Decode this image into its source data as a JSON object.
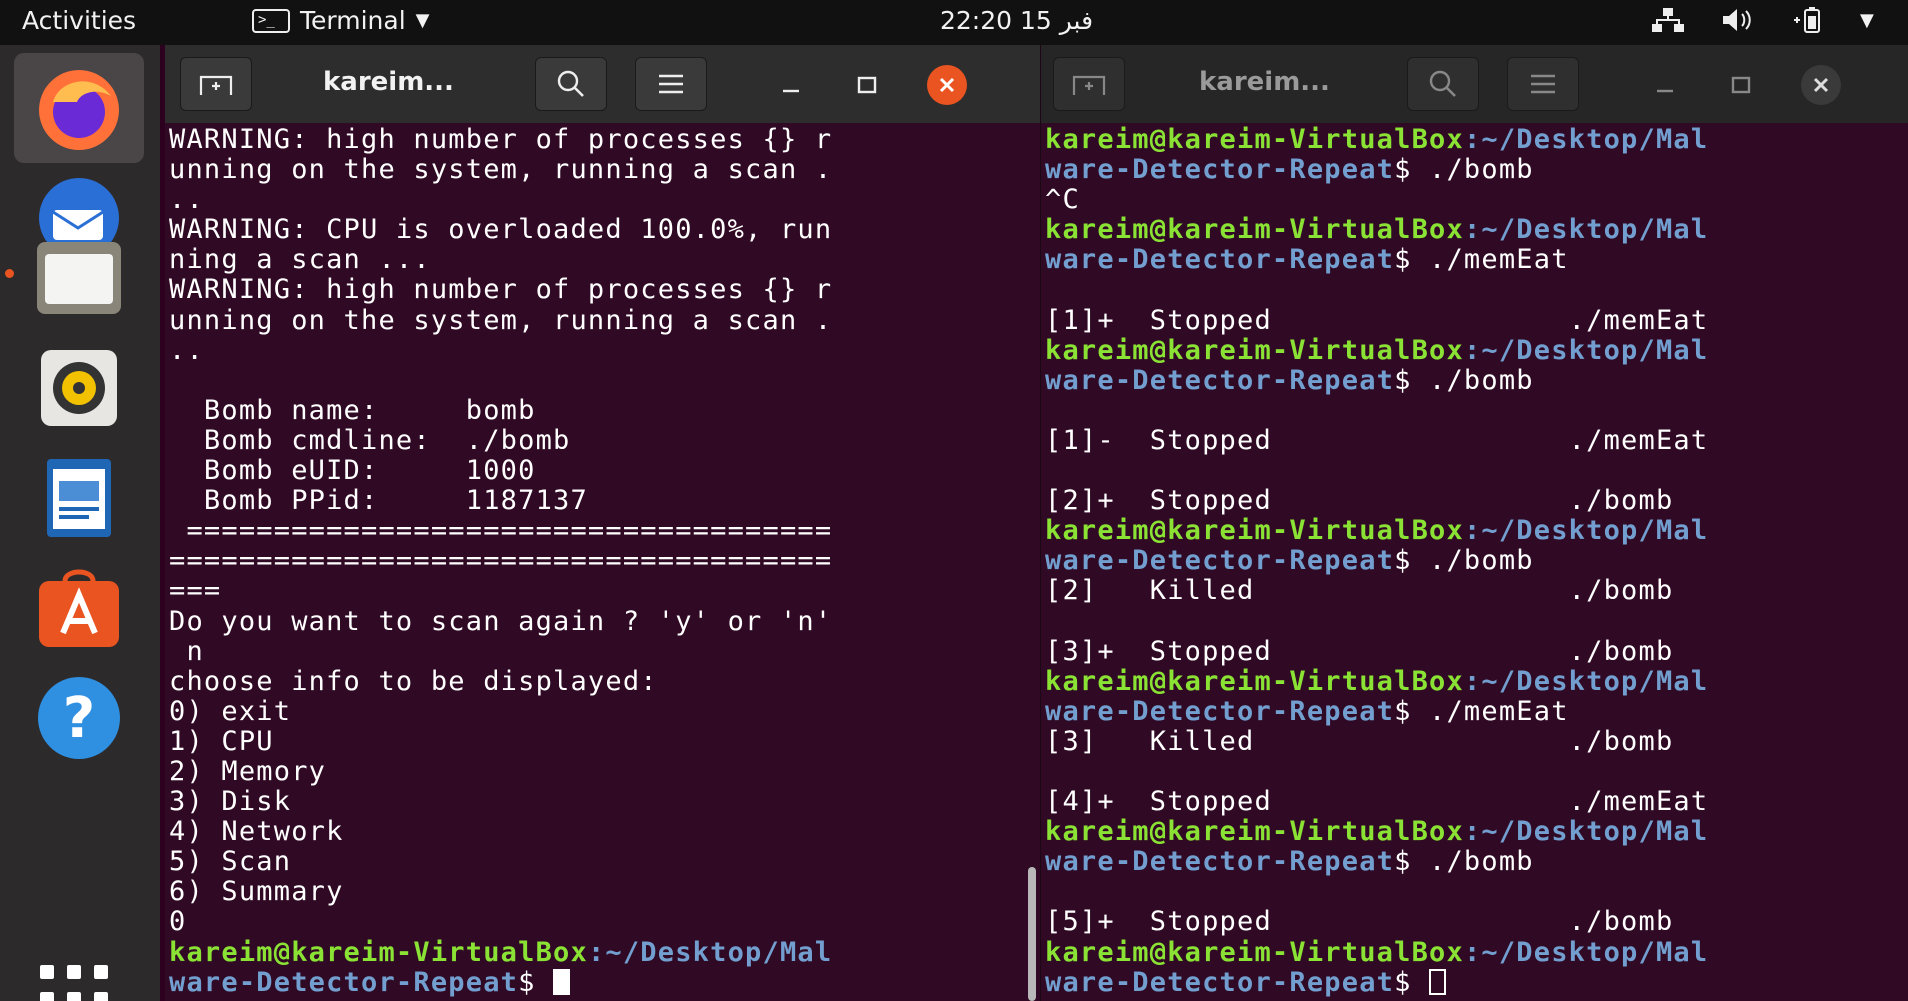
{
  "topbar": {
    "activities": "Activities",
    "app_name": "Terminal",
    "clock": "22:20  15 فبر",
    "tray_icons": [
      "network-icon",
      "volume-icon",
      "battery-icon",
      "system-menu-icon"
    ]
  },
  "dock": {
    "items": [
      {
        "name": "firefox",
        "active": true
      },
      {
        "name": "thunderbird"
      },
      {
        "name": "files",
        "running": true
      },
      {
        "name": "rhythmbox"
      },
      {
        "name": "libreoffice-writer"
      },
      {
        "name": "software-center"
      },
      {
        "name": "help"
      }
    ],
    "help_glyph": "?",
    "show_apps": "show-applications-icon"
  },
  "windows": {
    "left": {
      "title": "kareim...",
      "active": true,
      "lines": [
        {
          "t": "WARNING: high number of processes {} r"
        },
        {
          "t": "unning on the system, running a scan ."
        },
        {
          "t": ".."
        },
        {
          "t": "WARNING: CPU is overloaded 100.0%, run"
        },
        {
          "t": "ning a scan ..."
        },
        {
          "t": "WARNING: high number of processes {} r"
        },
        {
          "t": "unning on the system, running a scan ."
        },
        {
          "t": ".."
        },
        {
          "t": ""
        },
        {
          "t": "  Bomb name:     bomb"
        },
        {
          "t": "  Bomb cmdline:  ./bomb"
        },
        {
          "t": "  Bomb eUID:     1000"
        },
        {
          "t": "  Bomb PPid:     1187137"
        },
        {
          "t": " ====================================="
        },
        {
          "t": "======================================"
        },
        {
          "t": "==="
        },
        {
          "t": "Do you want to scan again ? 'y' or 'n'"
        },
        {
          "t": " n"
        },
        {
          "t": "choose info to be displayed:"
        },
        {
          "t": "0) exit"
        },
        {
          "t": "1) CPU"
        },
        {
          "t": "2) Memory"
        },
        {
          "t": "3) Disk"
        },
        {
          "t": "4) Network"
        },
        {
          "t": "5) Scan"
        },
        {
          "t": "6) Summary"
        },
        {
          "t": "0"
        },
        {
          "u": "kareim@kareim-VirtualBox",
          "p": ":~/Desktop/Mal"
        },
        {
          "p": "ware-Detector-Repeat",
          "t": "$ ",
          "cursor": "solid"
        }
      ]
    },
    "right": {
      "title": "kareim...",
      "active": false,
      "lines": [
        {
          "u": "kareim@kareim-VirtualBox",
          "p": ":~/Desktop/Mal"
        },
        {
          "p": "ware-Detector-Repeat",
          "t": "$ ./bomb"
        },
        {
          "t": "^C"
        },
        {
          "u": "kareim@kareim-VirtualBox",
          "p": ":~/Desktop/Mal"
        },
        {
          "p": "ware-Detector-Repeat",
          "t": "$ ./memEat"
        },
        {
          "t": ""
        },
        {
          "t": "[1]+  Stopped                 ./memEat"
        },
        {
          "u": "kareim@kareim-VirtualBox",
          "p": ":~/Desktop/Mal"
        },
        {
          "p": "ware-Detector-Repeat",
          "t": "$ ./bomb"
        },
        {
          "t": ""
        },
        {
          "t": "[1]-  Stopped                 ./memEat"
        },
        {
          "t": ""
        },
        {
          "t": "[2]+  Stopped                 ./bomb"
        },
        {
          "u": "kareim@kareim-VirtualBox",
          "p": ":~/Desktop/Mal"
        },
        {
          "p": "ware-Detector-Repeat",
          "t": "$ ./bomb"
        },
        {
          "t": "[2]   Killed                  ./bomb"
        },
        {
          "t": ""
        },
        {
          "t": "[3]+  Stopped                 ./bomb"
        },
        {
          "u": "kareim@kareim-VirtualBox",
          "p": ":~/Desktop/Mal"
        },
        {
          "p": "ware-Detector-Repeat",
          "t": "$ ./memEat"
        },
        {
          "t": "[3]   Killed                  ./bomb"
        },
        {
          "t": ""
        },
        {
          "t": "[4]+  Stopped                 ./memEat"
        },
        {
          "u": "kareim@kareim-VirtualBox",
          "p": ":~/Desktop/Mal"
        },
        {
          "p": "ware-Detector-Repeat",
          "t": "$ ./bomb"
        },
        {
          "t": ""
        },
        {
          "t": "[5]+  Stopped                 ./bomb"
        },
        {
          "u": "kareim@kareim-VirtualBox",
          "p": ":~/Desktop/Mal"
        },
        {
          "p": "ware-Detector-Repeat",
          "t": "$ ",
          "cursor": "hollow"
        }
      ]
    }
  },
  "colors": {
    "terminal_bg": "#300a24",
    "prompt_user": "#8ae234",
    "prompt_path": "#729fcf",
    "accent_close": "#e95420"
  }
}
